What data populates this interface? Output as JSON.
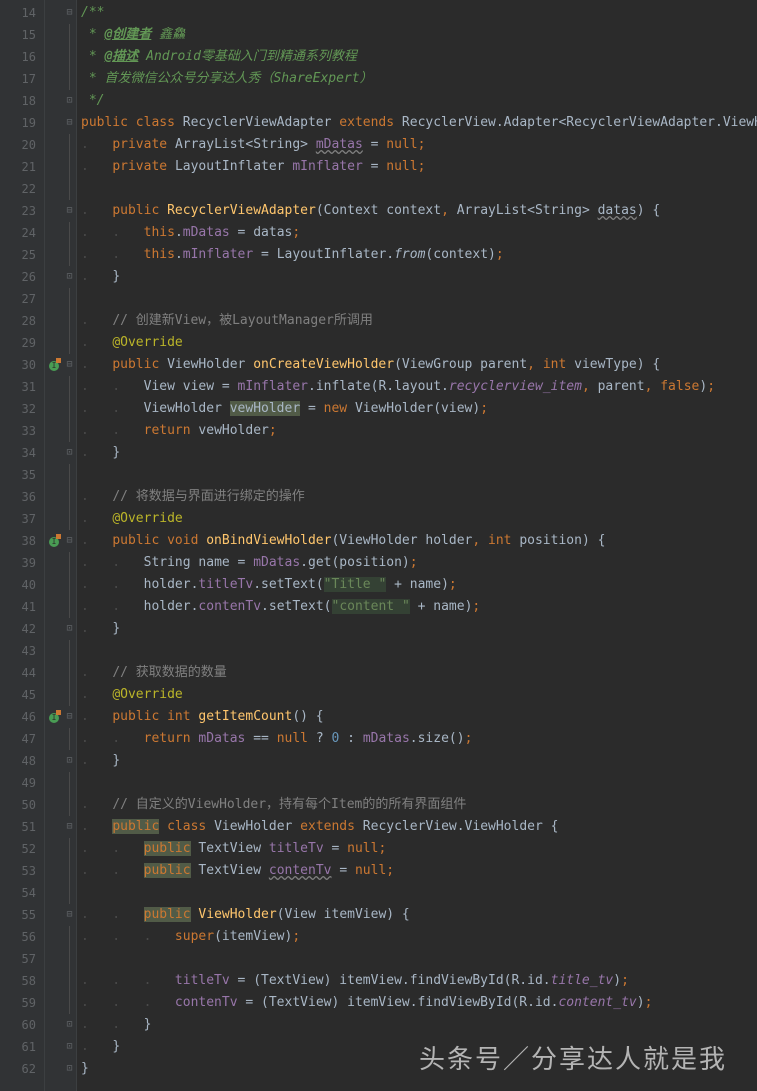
{
  "watermark": "头条号／分享达人就是我",
  "lines": [
    {
      "n": 14,
      "fold": "▾",
      "code": [
        {
          "t": "/**",
          "c": "c-doc"
        }
      ]
    },
    {
      "n": 15,
      "code": [
        {
          "t": " * ",
          "c": "c-doc"
        },
        {
          "t": "@创建者",
          "c": "c-doc-tag"
        },
        {
          "t": " 鑫鱻",
          "c": "c-doc"
        }
      ]
    },
    {
      "n": 16,
      "code": [
        {
          "t": " * ",
          "c": "c-doc"
        },
        {
          "t": "@描述",
          "c": "c-doc-tag"
        },
        {
          "t": " ",
          "c": "c-doc"
        },
        {
          "t": "Android零基础入门到精通系列教程",
          "c": "c-doc-link"
        }
      ]
    },
    {
      "n": 17,
      "code": [
        {
          "t": " * 首发微信公众号分享达人秀（ShareExpert）",
          "c": "c-doc"
        }
      ]
    },
    {
      "n": 18,
      "fold": "▴",
      "code": [
        {
          "t": " */",
          "c": "c-doc"
        }
      ]
    },
    {
      "n": 19,
      "fold": "▾",
      "code": [
        {
          "t": "public class ",
          "c": "c-keyword"
        },
        {
          "t": "RecyclerViewAdapter ",
          "c": "c-class"
        },
        {
          "t": "extends ",
          "c": "c-keyword"
        },
        {
          "t": "RecyclerView.Adapter<RecyclerViewAdapter.ViewHolder> {",
          "c": "c-class"
        }
      ]
    },
    {
      "n": 20,
      "ind": 1,
      "code": [
        {
          "t": "private ",
          "c": "c-keyword"
        },
        {
          "t": "ArrayList<String> ",
          "c": "c-class"
        },
        {
          "t": "mDatas",
          "c": "c-field-u"
        },
        {
          "t": " = ",
          "c": "c-op"
        },
        {
          "t": "null",
          "c": "c-keyword"
        },
        {
          "t": ";",
          "c": "c-semi"
        }
      ]
    },
    {
      "n": 21,
      "ind": 1,
      "code": [
        {
          "t": "private ",
          "c": "c-keyword"
        },
        {
          "t": "LayoutInflater ",
          "c": "c-class"
        },
        {
          "t": "mInflater",
          "c": "c-field"
        },
        {
          "t": " = ",
          "c": "c-op"
        },
        {
          "t": "null",
          "c": "c-keyword"
        },
        {
          "t": ";",
          "c": "c-semi"
        }
      ]
    },
    {
      "n": 22,
      "code": []
    },
    {
      "n": 23,
      "fold": "▾",
      "ind": 1,
      "code": [
        {
          "t": "public ",
          "c": "c-keyword"
        },
        {
          "t": "RecyclerViewAdapter",
          "c": "c-method"
        },
        {
          "t": "(Context context",
          "c": "c-paren"
        },
        {
          "t": ", ",
          "c": "c-semi"
        },
        {
          "t": "ArrayList<String> ",
          "c": "c-class"
        },
        {
          "t": "datas",
          "c": "c-param-u"
        },
        {
          "t": ") {",
          "c": "c-paren"
        }
      ]
    },
    {
      "n": 24,
      "ind": 2,
      "code": [
        {
          "t": "this",
          "c": "c-this"
        },
        {
          "t": ".",
          "c": "c-dot"
        },
        {
          "t": "mDatas",
          "c": "c-field"
        },
        {
          "t": " = datas",
          "c": "c-op"
        },
        {
          "t": ";",
          "c": "c-semi"
        }
      ]
    },
    {
      "n": 25,
      "ind": 2,
      "code": [
        {
          "t": "this",
          "c": "c-this"
        },
        {
          "t": ".",
          "c": "c-dot"
        },
        {
          "t": "mInflater",
          "c": "c-field"
        },
        {
          "t": " = LayoutInflater.",
          "c": "c-op"
        },
        {
          "t": "from",
          "c": "c-static"
        },
        {
          "t": "(context)",
          "c": "c-paren"
        },
        {
          "t": ";",
          "c": "c-semi"
        }
      ]
    },
    {
      "n": 26,
      "fold": "▴",
      "ind": 1,
      "code": [
        {
          "t": "}",
          "c": "c-paren"
        }
      ]
    },
    {
      "n": 27,
      "code": []
    },
    {
      "n": 28,
      "ind": 1,
      "code": [
        {
          "t": "// 创建新View，被LayoutManager所调用",
          "c": "c-comment"
        }
      ]
    },
    {
      "n": 29,
      "ind": 1,
      "code": [
        {
          "t": "@Override",
          "c": "c-annotation"
        }
      ]
    },
    {
      "n": 30,
      "marker": true,
      "fold": "▾",
      "ind": 1,
      "code": [
        {
          "t": "public ",
          "c": "c-keyword"
        },
        {
          "t": "ViewHolder ",
          "c": "c-class"
        },
        {
          "t": "onCreateViewHolder",
          "c": "c-method"
        },
        {
          "t": "(ViewGroup parent",
          "c": "c-paren"
        },
        {
          "t": ", ",
          "c": "c-semi"
        },
        {
          "t": "int ",
          "c": "c-keyword"
        },
        {
          "t": "viewType) {",
          "c": "c-paren"
        }
      ]
    },
    {
      "n": 31,
      "ind": 2,
      "code": [
        {
          "t": "View view = ",
          "c": "c-op"
        },
        {
          "t": "mInflater",
          "c": "c-field"
        },
        {
          "t": ".inflate(R.layout.",
          "c": "c-op"
        },
        {
          "t": "recyclerview_item",
          "c": "c-field c-italic"
        },
        {
          "t": ", ",
          "c": "c-semi"
        },
        {
          "t": "parent",
          "c": "c-op"
        },
        {
          "t": ", ",
          "c": "c-semi"
        },
        {
          "t": "false",
          "c": "c-keyword"
        },
        {
          "t": ")",
          "c": "c-paren"
        },
        {
          "t": ";",
          "c": "c-semi"
        }
      ]
    },
    {
      "n": 32,
      "ind": 2,
      "code": [
        {
          "t": "ViewHolder ",
          "c": "c-class"
        },
        {
          "t": "vewHolder",
          "c": "c-hl-bg"
        },
        {
          "t": " = ",
          "c": "c-op"
        },
        {
          "t": "new ",
          "c": "c-keyword"
        },
        {
          "t": "ViewHolder(view)",
          "c": "c-paren"
        },
        {
          "t": ";",
          "c": "c-semi"
        }
      ]
    },
    {
      "n": 33,
      "ind": 2,
      "code": [
        {
          "t": "return ",
          "c": "c-keyword"
        },
        {
          "t": "vewHolder",
          "c": "c-op"
        },
        {
          "t": ";",
          "c": "c-semi"
        }
      ]
    },
    {
      "n": 34,
      "fold": "▴",
      "ind": 1,
      "code": [
        {
          "t": "}",
          "c": "c-paren"
        }
      ]
    },
    {
      "n": 35,
      "code": []
    },
    {
      "n": 36,
      "ind": 1,
      "code": [
        {
          "t": "// 将数据与界面进行绑定的操作",
          "c": "c-comment"
        }
      ]
    },
    {
      "n": 37,
      "ind": 1,
      "code": [
        {
          "t": "@Override",
          "c": "c-annotation"
        }
      ]
    },
    {
      "n": 38,
      "marker": true,
      "fold": "▾",
      "ind": 1,
      "code": [
        {
          "t": "public void ",
          "c": "c-keyword"
        },
        {
          "t": "onBindViewHolder",
          "c": "c-method"
        },
        {
          "t": "(ViewHolder holder",
          "c": "c-paren"
        },
        {
          "t": ", ",
          "c": "c-semi"
        },
        {
          "t": "int ",
          "c": "c-keyword"
        },
        {
          "t": "position) {",
          "c": "c-paren"
        }
      ]
    },
    {
      "n": 39,
      "ind": 2,
      "code": [
        {
          "t": "String name = ",
          "c": "c-op"
        },
        {
          "t": "mDatas",
          "c": "c-field"
        },
        {
          "t": ".get(position)",
          "c": "c-op"
        },
        {
          "t": ";",
          "c": "c-semi"
        }
      ]
    },
    {
      "n": 40,
      "ind": 2,
      "code": [
        {
          "t": "holder.",
          "c": "c-op"
        },
        {
          "t": "titleTv",
          "c": "c-field"
        },
        {
          "t": ".setText(",
          "c": "c-op"
        },
        {
          "t": "\"Title \"",
          "c": "c-string-hl"
        },
        {
          "t": " + name)",
          "c": "c-op"
        },
        {
          "t": ";",
          "c": "c-semi"
        }
      ]
    },
    {
      "n": 41,
      "ind": 2,
      "code": [
        {
          "t": "holder.",
          "c": "c-op"
        },
        {
          "t": "contenTv",
          "c": "c-field"
        },
        {
          "t": ".setText(",
          "c": "c-op"
        },
        {
          "t": "\"content \"",
          "c": "c-string-hl"
        },
        {
          "t": " + name)",
          "c": "c-op"
        },
        {
          "t": ";",
          "c": "c-semi"
        }
      ]
    },
    {
      "n": 42,
      "fold": "▴",
      "ind": 1,
      "code": [
        {
          "t": "}",
          "c": "c-paren"
        }
      ]
    },
    {
      "n": 43,
      "code": []
    },
    {
      "n": 44,
      "ind": 1,
      "code": [
        {
          "t": "// 获取数据的数量",
          "c": "c-comment"
        }
      ]
    },
    {
      "n": 45,
      "ind": 1,
      "code": [
        {
          "t": "@Override",
          "c": "c-annotation"
        }
      ]
    },
    {
      "n": 46,
      "marker": true,
      "fold": "▾",
      "ind": 1,
      "code": [
        {
          "t": "public int ",
          "c": "c-keyword"
        },
        {
          "t": "getItemCount",
          "c": "c-method"
        },
        {
          "t": "() {",
          "c": "c-paren"
        }
      ]
    },
    {
      "n": 47,
      "ind": 2,
      "code": [
        {
          "t": "return ",
          "c": "c-keyword"
        },
        {
          "t": "mDatas",
          "c": "c-field"
        },
        {
          "t": " == ",
          "c": "c-op"
        },
        {
          "t": "null ",
          "c": "c-keyword"
        },
        {
          "t": "? ",
          "c": "c-op"
        },
        {
          "t": "0 ",
          "c": "c-num"
        },
        {
          "t": ": ",
          "c": "c-op"
        },
        {
          "t": "mDatas",
          "c": "c-field"
        },
        {
          "t": ".size()",
          "c": "c-op"
        },
        {
          "t": ";",
          "c": "c-semi"
        }
      ]
    },
    {
      "n": 48,
      "fold": "▴",
      "ind": 1,
      "code": [
        {
          "t": "}",
          "c": "c-paren"
        }
      ]
    },
    {
      "n": 49,
      "code": []
    },
    {
      "n": 50,
      "ind": 1,
      "code": [
        {
          "t": "// 自定义的ViewHolder，持有每个Item的的所有界面组件",
          "c": "c-comment"
        }
      ]
    },
    {
      "n": 51,
      "fold": "▾",
      "ind": 1,
      "code": [
        {
          "t": "public",
          "c": "c-keyword c-hl-bg"
        },
        {
          "t": " ",
          "c": ""
        },
        {
          "t": "class ",
          "c": "c-keyword"
        },
        {
          "t": "ViewHolder ",
          "c": "c-class"
        },
        {
          "t": "extends ",
          "c": "c-keyword"
        },
        {
          "t": "RecyclerView.ViewHolder {",
          "c": "c-class"
        }
      ]
    },
    {
      "n": 52,
      "ind": 2,
      "code": [
        {
          "t": "public",
          "c": "c-keyword c-hl-bg"
        },
        {
          "t": " TextView ",
          "c": "c-class"
        },
        {
          "t": "titleTv",
          "c": "c-field"
        },
        {
          "t": " = ",
          "c": "c-op"
        },
        {
          "t": "null",
          "c": "c-keyword"
        },
        {
          "t": ";",
          "c": "c-semi"
        }
      ]
    },
    {
      "n": 53,
      "ind": 2,
      "code": [
        {
          "t": "public",
          "c": "c-keyword c-hl-bg"
        },
        {
          "t": " TextView ",
          "c": "c-class"
        },
        {
          "t": "contenTv",
          "c": "c-field-u"
        },
        {
          "t": " = ",
          "c": "c-op"
        },
        {
          "t": "null",
          "c": "c-keyword"
        },
        {
          "t": ";",
          "c": "c-semi"
        }
      ]
    },
    {
      "n": 54,
      "code": []
    },
    {
      "n": 55,
      "fold": "▾",
      "ind": 2,
      "code": [
        {
          "t": "public",
          "c": "c-keyword c-hl-bg"
        },
        {
          "t": " ",
          "c": ""
        },
        {
          "t": "ViewHolder",
          "c": "c-method"
        },
        {
          "t": "(View itemView) {",
          "c": "c-paren"
        }
      ]
    },
    {
      "n": 56,
      "ind": 3,
      "code": [
        {
          "t": "super",
          "c": "c-keyword"
        },
        {
          "t": "(itemView)",
          "c": "c-paren"
        },
        {
          "t": ";",
          "c": "c-semi"
        }
      ]
    },
    {
      "n": 57,
      "code": []
    },
    {
      "n": 58,
      "ind": 3,
      "code": [
        {
          "t": "titleTv",
          "c": "c-field"
        },
        {
          "t": " = (TextView) itemView.findViewById(R.id.",
          "c": "c-op"
        },
        {
          "t": "title_tv",
          "c": "c-field c-italic"
        },
        {
          "t": ")",
          "c": "c-paren"
        },
        {
          "t": ";",
          "c": "c-semi"
        }
      ]
    },
    {
      "n": 59,
      "ind": 3,
      "code": [
        {
          "t": "contenTv",
          "c": "c-field"
        },
        {
          "t": " = (TextView) itemView.findViewById(R.id.",
          "c": "c-op"
        },
        {
          "t": "content_tv",
          "c": "c-field c-italic"
        },
        {
          "t": ")",
          "c": "c-paren"
        },
        {
          "t": ";",
          "c": "c-semi"
        }
      ]
    },
    {
      "n": 60,
      "fold": "▴",
      "ind": 2,
      "code": [
        {
          "t": "}",
          "c": "c-paren"
        }
      ]
    },
    {
      "n": 61,
      "fold": "▴",
      "ind": 1,
      "code": [
        {
          "t": "}",
          "c": "c-paren"
        }
      ]
    },
    {
      "n": 62,
      "fold": "▴",
      "code": [
        {
          "t": "}",
          "c": "c-paren"
        }
      ]
    }
  ]
}
